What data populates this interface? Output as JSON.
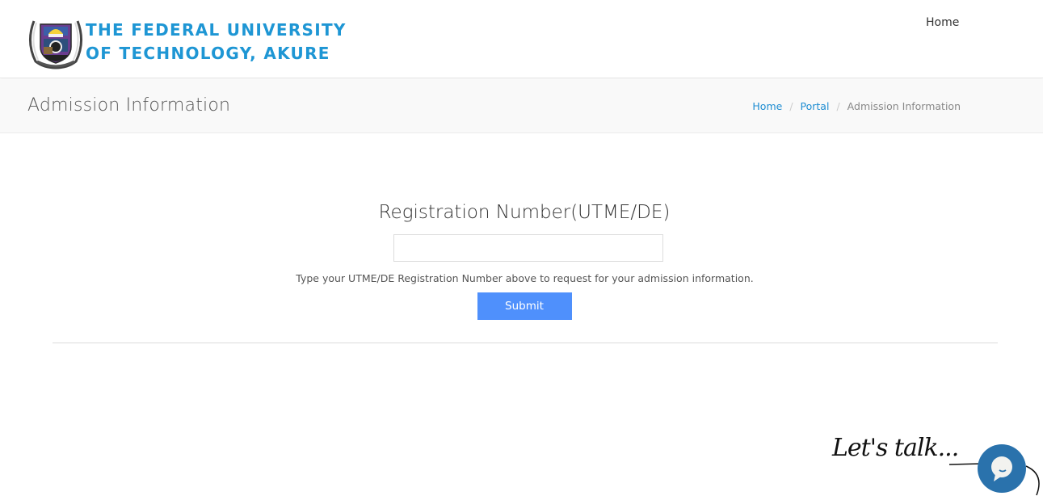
{
  "header": {
    "logo_alt": "FUTA crest",
    "logo_line1": "THE FEDERAL UNIVERSITY",
    "logo_line2": "OF TECHNOLOGY, AKURE",
    "nav": [
      {
        "label": "Home"
      }
    ]
  },
  "titlebar": {
    "title": "Admission Information",
    "breadcrumb": [
      {
        "label": "Home",
        "link": true
      },
      {
        "label": "Portal",
        "link": true
      },
      {
        "label": "Admission Information",
        "link": false
      }
    ],
    "separator": "/"
  },
  "form": {
    "label": "Registration Number(UTME/DE)",
    "input_value": "",
    "input_placeholder": "",
    "help_text": "Type your UTME/DE Registration Number above to request for your admission information.",
    "submit_label": "Submit"
  },
  "chat": {
    "prompt": "Let's talk...",
    "icon": "chat-bubble-icon"
  },
  "colors": {
    "brand_blue": "#1e96d4",
    "link_blue": "#1e8dd2",
    "button_blue": "#4f90fc",
    "chat_blue": "#2a72ac"
  }
}
